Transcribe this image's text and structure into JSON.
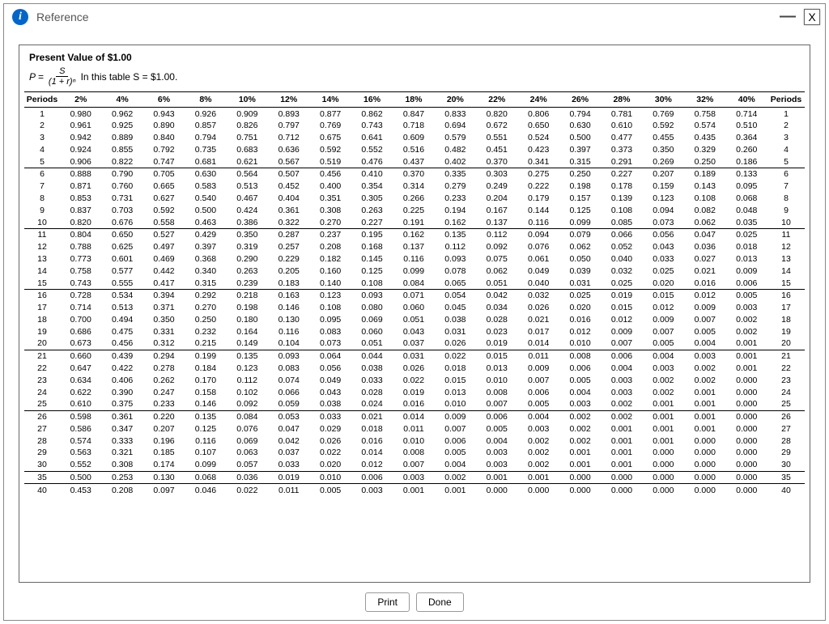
{
  "header": {
    "icon_label": "i",
    "title": "Reference",
    "minimize": "—",
    "close": "X"
  },
  "table": {
    "title": "Present Value of $1.00",
    "formula_prefix": "P =",
    "formula_numer": "S",
    "formula_denom": "(1 + r)ⁿ",
    "formula_suffix": "In this table S = $1.00.",
    "col_label_left": "Periods",
    "col_label_right": "Periods",
    "rates": [
      "2%",
      "4%",
      "6%",
      "8%",
      "10%",
      "12%",
      "14%",
      "16%",
      "18%",
      "20%",
      "22%",
      "24%",
      "26%",
      "28%",
      "30%",
      "32%",
      "40%"
    ],
    "periods": [
      1,
      2,
      3,
      4,
      5,
      6,
      7,
      8,
      9,
      10,
      11,
      12,
      13,
      14,
      15,
      16,
      17,
      18,
      19,
      20,
      21,
      22,
      23,
      24,
      25,
      26,
      27,
      28,
      29,
      30,
      35,
      40
    ],
    "rows": [
      [
        "0.980",
        "0.962",
        "0.943",
        "0.926",
        "0.909",
        "0.893",
        "0.877",
        "0.862",
        "0.847",
        "0.833",
        "0.820",
        "0.806",
        "0.794",
        "0.781",
        "0.769",
        "0.758",
        "0.714"
      ],
      [
        "0.961",
        "0.925",
        "0.890",
        "0.857",
        "0.826",
        "0.797",
        "0.769",
        "0.743",
        "0.718",
        "0.694",
        "0.672",
        "0.650",
        "0.630",
        "0.610",
        "0.592",
        "0.574",
        "0.510"
      ],
      [
        "0.942",
        "0.889",
        "0.840",
        "0.794",
        "0.751",
        "0.712",
        "0.675",
        "0.641",
        "0.609",
        "0.579",
        "0.551",
        "0.524",
        "0.500",
        "0.477",
        "0.455",
        "0.435",
        "0.364"
      ],
      [
        "0.924",
        "0.855",
        "0.792",
        "0.735",
        "0.683",
        "0.636",
        "0.592",
        "0.552",
        "0.516",
        "0.482",
        "0.451",
        "0.423",
        "0.397",
        "0.373",
        "0.350",
        "0.329",
        "0.260"
      ],
      [
        "0.906",
        "0.822",
        "0.747",
        "0.681",
        "0.621",
        "0.567",
        "0.519",
        "0.476",
        "0.437",
        "0.402",
        "0.370",
        "0.341",
        "0.315",
        "0.291",
        "0.269",
        "0.250",
        "0.186"
      ],
      [
        "0.888",
        "0.790",
        "0.705",
        "0.630",
        "0.564",
        "0.507",
        "0.456",
        "0.410",
        "0.370",
        "0.335",
        "0.303",
        "0.275",
        "0.250",
        "0.227",
        "0.207",
        "0.189",
        "0.133"
      ],
      [
        "0.871",
        "0.760",
        "0.665",
        "0.583",
        "0.513",
        "0.452",
        "0.400",
        "0.354",
        "0.314",
        "0.279",
        "0.249",
        "0.222",
        "0.198",
        "0.178",
        "0.159",
        "0.143",
        "0.095"
      ],
      [
        "0.853",
        "0.731",
        "0.627",
        "0.540",
        "0.467",
        "0.404",
        "0.351",
        "0.305",
        "0.266",
        "0.233",
        "0.204",
        "0.179",
        "0.157",
        "0.139",
        "0.123",
        "0.108",
        "0.068"
      ],
      [
        "0.837",
        "0.703",
        "0.592",
        "0.500",
        "0.424",
        "0.361",
        "0.308",
        "0.263",
        "0.225",
        "0.194",
        "0.167",
        "0.144",
        "0.125",
        "0.108",
        "0.094",
        "0.082",
        "0.048"
      ],
      [
        "0.820",
        "0.676",
        "0.558",
        "0.463",
        "0.386",
        "0.322",
        "0.270",
        "0.227",
        "0.191",
        "0.162",
        "0.137",
        "0.116",
        "0.099",
        "0.085",
        "0.073",
        "0.062",
        "0.035"
      ],
      [
        "0.804",
        "0.650",
        "0.527",
        "0.429",
        "0.350",
        "0.287",
        "0.237",
        "0.195",
        "0.162",
        "0.135",
        "0.112",
        "0.094",
        "0.079",
        "0.066",
        "0.056",
        "0.047",
        "0.025"
      ],
      [
        "0.788",
        "0.625",
        "0.497",
        "0.397",
        "0.319",
        "0.257",
        "0.208",
        "0.168",
        "0.137",
        "0.112",
        "0.092",
        "0.076",
        "0.062",
        "0.052",
        "0.043",
        "0.036",
        "0.018"
      ],
      [
        "0.773",
        "0.601",
        "0.469",
        "0.368",
        "0.290",
        "0.229",
        "0.182",
        "0.145",
        "0.116",
        "0.093",
        "0.075",
        "0.061",
        "0.050",
        "0.040",
        "0.033",
        "0.027",
        "0.013"
      ],
      [
        "0.758",
        "0.577",
        "0.442",
        "0.340",
        "0.263",
        "0.205",
        "0.160",
        "0.125",
        "0.099",
        "0.078",
        "0.062",
        "0.049",
        "0.039",
        "0.032",
        "0.025",
        "0.021",
        "0.009"
      ],
      [
        "0.743",
        "0.555",
        "0.417",
        "0.315",
        "0.239",
        "0.183",
        "0.140",
        "0.108",
        "0.084",
        "0.065",
        "0.051",
        "0.040",
        "0.031",
        "0.025",
        "0.020",
        "0.016",
        "0.006"
      ],
      [
        "0.728",
        "0.534",
        "0.394",
        "0.292",
        "0.218",
        "0.163",
        "0.123",
        "0.093",
        "0.071",
        "0.054",
        "0.042",
        "0.032",
        "0.025",
        "0.019",
        "0.015",
        "0.012",
        "0.005"
      ],
      [
        "0.714",
        "0.513",
        "0.371",
        "0.270",
        "0.198",
        "0.146",
        "0.108",
        "0.080",
        "0.060",
        "0.045",
        "0.034",
        "0.026",
        "0.020",
        "0.015",
        "0.012",
        "0.009",
        "0.003"
      ],
      [
        "0.700",
        "0.494",
        "0.350",
        "0.250",
        "0.180",
        "0.130",
        "0.095",
        "0.069",
        "0.051",
        "0.038",
        "0.028",
        "0.021",
        "0.016",
        "0.012",
        "0.009",
        "0.007",
        "0.002"
      ],
      [
        "0.686",
        "0.475",
        "0.331",
        "0.232",
        "0.164",
        "0.116",
        "0.083",
        "0.060",
        "0.043",
        "0.031",
        "0.023",
        "0.017",
        "0.012",
        "0.009",
        "0.007",
        "0.005",
        "0.002"
      ],
      [
        "0.673",
        "0.456",
        "0.312",
        "0.215",
        "0.149",
        "0.104",
        "0.073",
        "0.051",
        "0.037",
        "0.026",
        "0.019",
        "0.014",
        "0.010",
        "0.007",
        "0.005",
        "0.004",
        "0.001"
      ],
      [
        "0.660",
        "0.439",
        "0.294",
        "0.199",
        "0.135",
        "0.093",
        "0.064",
        "0.044",
        "0.031",
        "0.022",
        "0.015",
        "0.011",
        "0.008",
        "0.006",
        "0.004",
        "0.003",
        "0.001"
      ],
      [
        "0.647",
        "0.422",
        "0.278",
        "0.184",
        "0.123",
        "0.083",
        "0.056",
        "0.038",
        "0.026",
        "0.018",
        "0.013",
        "0.009",
        "0.006",
        "0.004",
        "0.003",
        "0.002",
        "0.001"
      ],
      [
        "0.634",
        "0.406",
        "0.262",
        "0.170",
        "0.112",
        "0.074",
        "0.049",
        "0.033",
        "0.022",
        "0.015",
        "0.010",
        "0.007",
        "0.005",
        "0.003",
        "0.002",
        "0.002",
        "0.000"
      ],
      [
        "0.622",
        "0.390",
        "0.247",
        "0.158",
        "0.102",
        "0.066",
        "0.043",
        "0.028",
        "0.019",
        "0.013",
        "0.008",
        "0.006",
        "0.004",
        "0.003",
        "0.002",
        "0.001",
        "0.000"
      ],
      [
        "0.610",
        "0.375",
        "0.233",
        "0.146",
        "0.092",
        "0.059",
        "0.038",
        "0.024",
        "0.016",
        "0.010",
        "0.007",
        "0.005",
        "0.003",
        "0.002",
        "0.001",
        "0.001",
        "0.000"
      ],
      [
        "0.598",
        "0.361",
        "0.220",
        "0.135",
        "0.084",
        "0.053",
        "0.033",
        "0.021",
        "0.014",
        "0.009",
        "0.006",
        "0.004",
        "0.002",
        "0.002",
        "0.001",
        "0.001",
        "0.000"
      ],
      [
        "0.586",
        "0.347",
        "0.207",
        "0.125",
        "0.076",
        "0.047",
        "0.029",
        "0.018",
        "0.011",
        "0.007",
        "0.005",
        "0.003",
        "0.002",
        "0.001",
        "0.001",
        "0.001",
        "0.000"
      ],
      [
        "0.574",
        "0.333",
        "0.196",
        "0.116",
        "0.069",
        "0.042",
        "0.026",
        "0.016",
        "0.010",
        "0.006",
        "0.004",
        "0.002",
        "0.002",
        "0.001",
        "0.001",
        "0.000",
        "0.000"
      ],
      [
        "0.563",
        "0.321",
        "0.185",
        "0.107",
        "0.063",
        "0.037",
        "0.022",
        "0.014",
        "0.008",
        "0.005",
        "0.003",
        "0.002",
        "0.001",
        "0.001",
        "0.000",
        "0.000",
        "0.000"
      ],
      [
        "0.552",
        "0.308",
        "0.174",
        "0.099",
        "0.057",
        "0.033",
        "0.020",
        "0.012",
        "0.007",
        "0.004",
        "0.003",
        "0.002",
        "0.001",
        "0.001",
        "0.000",
        "0.000",
        "0.000"
      ],
      [
        "0.500",
        "0.253",
        "0.130",
        "0.068",
        "0.036",
        "0.019",
        "0.010",
        "0.006",
        "0.003",
        "0.002",
        "0.001",
        "0.001",
        "0.000",
        "0.000",
        "0.000",
        "0.000",
        "0.000"
      ],
      [
        "0.453",
        "0.208",
        "0.097",
        "0.046",
        "0.022",
        "0.011",
        "0.005",
        "0.003",
        "0.001",
        "0.001",
        "0.000",
        "0.000",
        "0.000",
        "0.000",
        "0.000",
        "0.000",
        "0.000"
      ]
    ]
  },
  "buttons": {
    "print": "Print",
    "done": "Done"
  }
}
